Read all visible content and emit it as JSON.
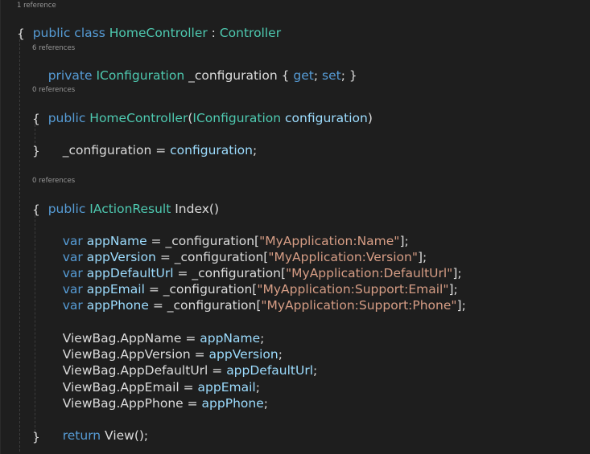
{
  "code_lens": {
    "class_refs": "1 reference",
    "config_refs": "6 references",
    "ctor_refs": "0 references",
    "index_refs": "0 references"
  },
  "lines": {
    "class_decl": [
      "public",
      " ",
      "class",
      " ",
      "HomeController",
      " : ",
      "Controller"
    ],
    "open_class": "{",
    "field": [
      "private",
      " ",
      "IConfiguration",
      " _configuration { ",
      "get",
      "; ",
      "set",
      "; }"
    ],
    "ctor_sig": [
      "public",
      " ",
      "HomeController",
      "(",
      "IConfiguration",
      " ",
      "configuration",
      ")"
    ],
    "ctor_open": "{",
    "ctor_body": [
      "_configuration",
      " = ",
      "configuration",
      ";"
    ],
    "ctor_close": "}",
    "index_sig": [
      "public",
      " ",
      "IActionResult",
      " Index()"
    ],
    "index_open": "{",
    "var_name": [
      "var",
      " ",
      "appName",
      " = _configuration[",
      "\"MyApplication:Name\"",
      "];"
    ],
    "var_version": [
      "var",
      " ",
      "appVersion",
      " = _configuration[",
      "\"MyApplication:Version\"",
      "];"
    ],
    "var_url": [
      "var",
      " ",
      "appDefaultUrl",
      " = _configuration[",
      "\"MyApplication:DefaultUrl\"",
      "];"
    ],
    "var_email": [
      "var",
      " ",
      "appEmail",
      " = _configuration[",
      "\"MyApplication:Support:Email\"",
      "];"
    ],
    "var_phone": [
      "var",
      " ",
      "appPhone",
      " = _configuration[",
      "\"MyApplication:Support:Phone\"",
      "];"
    ],
    "vb_name": [
      "ViewBag.AppName = ",
      "appName",
      ";"
    ],
    "vb_version": [
      "ViewBag.AppVersion = ",
      "appVersion",
      ";"
    ],
    "vb_url": [
      "ViewBag.AppDefaultUrl = ",
      "appDefaultUrl",
      ";"
    ],
    "vb_email": [
      "ViewBag.AppEmail = ",
      "appEmail",
      ";"
    ],
    "vb_phone": [
      "ViewBag.AppPhone = ",
      "appPhone",
      ";"
    ],
    "return_stmt": [
      "return",
      " View();"
    ],
    "index_close": "}"
  },
  "colors": {
    "background": "#1e1e1e",
    "keyword": "#569cd6",
    "type": "#4ec9b0",
    "string": "#d69d85",
    "variable": "#9cdcfe",
    "plain": "#dcdcdc",
    "code_lens": "#999999"
  }
}
